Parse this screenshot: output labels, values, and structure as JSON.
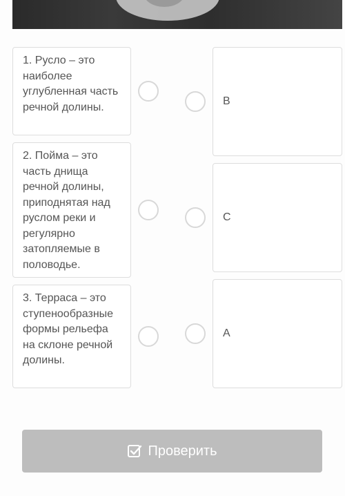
{
  "matching": {
    "statements": [
      {
        "text": "1. Русло – это наиболее углубленная часть речной долины."
      },
      {
        "text": "2. Пойма – это часть днища речной долины, приподнятая над руслом реки и регулярно затопляемые в половодье."
      },
      {
        "text": "3. Терраса – это ступенообразные формы рельефа на склоне речной долины."
      }
    ],
    "answers": [
      {
        "text": "B"
      },
      {
        "text": "C"
      },
      {
        "text": "A"
      }
    ]
  },
  "check_button": {
    "label": "Проверить",
    "icon": "checkbox-check-icon"
  },
  "colors": {
    "button_bg": "#bdbdbd",
    "border": "#dddddd",
    "radio_border": "#d8d8d8",
    "text": "#555555"
  }
}
